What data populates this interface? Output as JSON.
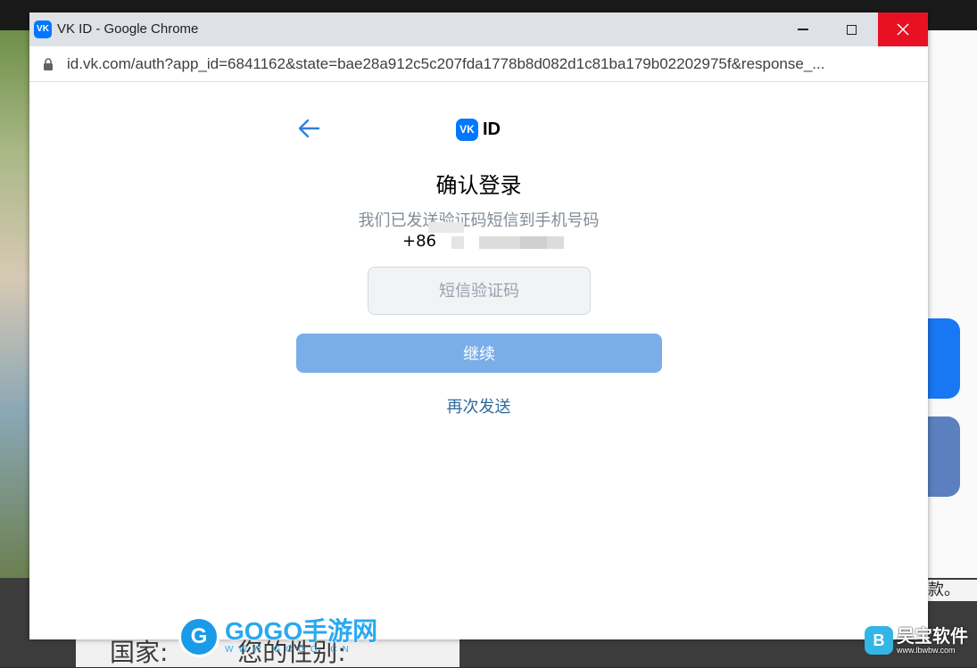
{
  "window": {
    "title": "VK ID - Google Chrome",
    "app_icon_text": "VK",
    "controls": {
      "minimize": "minimize",
      "maximize": "maximize",
      "close": "close"
    }
  },
  "address_bar": {
    "url": "id.vk.com/auth?app_id=6841162&state=bae28a912c5c207fda1778b8d082d1c81ba179b02202975f&response_..."
  },
  "page": {
    "logo_mark": "VK",
    "logo_text": "ID",
    "heading": "确认登录",
    "subtitle": "我们已发送验证码短信到手机号码",
    "phone_prefix": "+86",
    "sms_placeholder": "短信验证码",
    "continue_label": "继续",
    "resend_label": "再次发送",
    "colors": {
      "vk_blue": "#0077ff",
      "button_disabled": "#7aaee8",
      "link": "#2f6a9c",
      "close_red": "#e81123"
    }
  },
  "background": {
    "right_snippet": "款。 ",
    "country_label": "国家: ",
    "gender_label": "您的性别: "
  },
  "watermarks": {
    "gogo_logo": "G",
    "gogo_title": "GOGO手游网",
    "gogo_url": "WWW.GOGO.CN",
    "lbw_logo": "B",
    "lbw_title": "吴宝软件",
    "lbw_url": "www.lbwbw.com"
  }
}
